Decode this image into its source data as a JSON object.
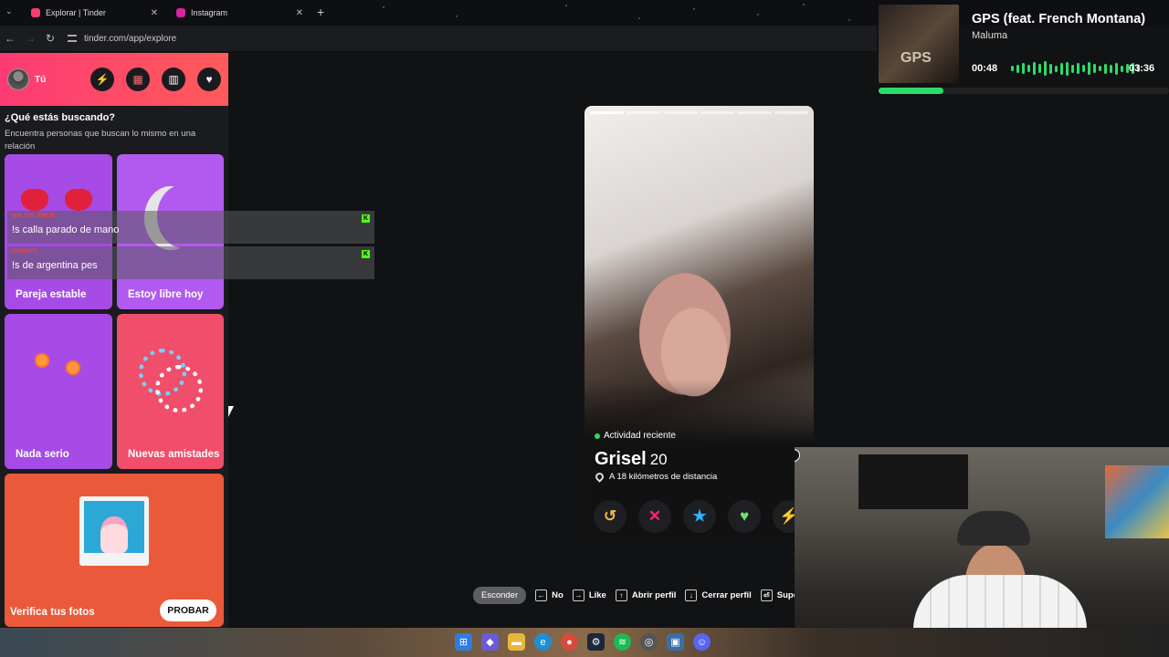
{
  "browser": {
    "tabs": [
      {
        "title": "Explorar | Tinder",
        "color": "#fe3c72"
      },
      {
        "title": "Instagram",
        "color": "#d6249f"
      }
    ],
    "url": "tinder.com/app/explore"
  },
  "sidebar": {
    "user_label": "Tú",
    "section_title": "¿Qué estás buscando?",
    "section_subtitle": "Encuentra personas que buscan lo mismo en una relación",
    "cards": [
      {
        "label": "Pareja estable"
      },
      {
        "label": "Estoy libre hoy"
      },
      {
        "label": "Nada serio"
      },
      {
        "label": "Nuevas amistades"
      },
      {
        "label": "Verifica tus fotos",
        "button": "PROBAR"
      }
    ]
  },
  "chat": {
    "messages": [
      {
        "user": "WALTER JORGE",
        "text": "!s calla parado de mano"
      },
      {
        "user": "ZADOFFY",
        "text": "!s de argentina pes"
      }
    ]
  },
  "profile": {
    "activity": "Actividad reciente",
    "name": "Grisel",
    "age": "20",
    "distance": "A 18 kilómetros de distancia",
    "photo_count": 6
  },
  "shortcuts": {
    "hide": "Esconder",
    "items": [
      {
        "key": "←",
        "label": "No"
      },
      {
        "key": "→",
        "label": "Like"
      },
      {
        "key": "↑",
        "label": "Abrir perfil"
      },
      {
        "key": "↓",
        "label": "Cerrar perfil"
      },
      {
        "key": "⏎",
        "label": "Supe"
      }
    ]
  },
  "spotify": {
    "title": "GPS (feat. French Montana)",
    "artist": "Maluma",
    "current": "00:48",
    "total": "03:36",
    "progress": 0.222,
    "cover_text": "GPS",
    "accent": "#2ddc68"
  }
}
